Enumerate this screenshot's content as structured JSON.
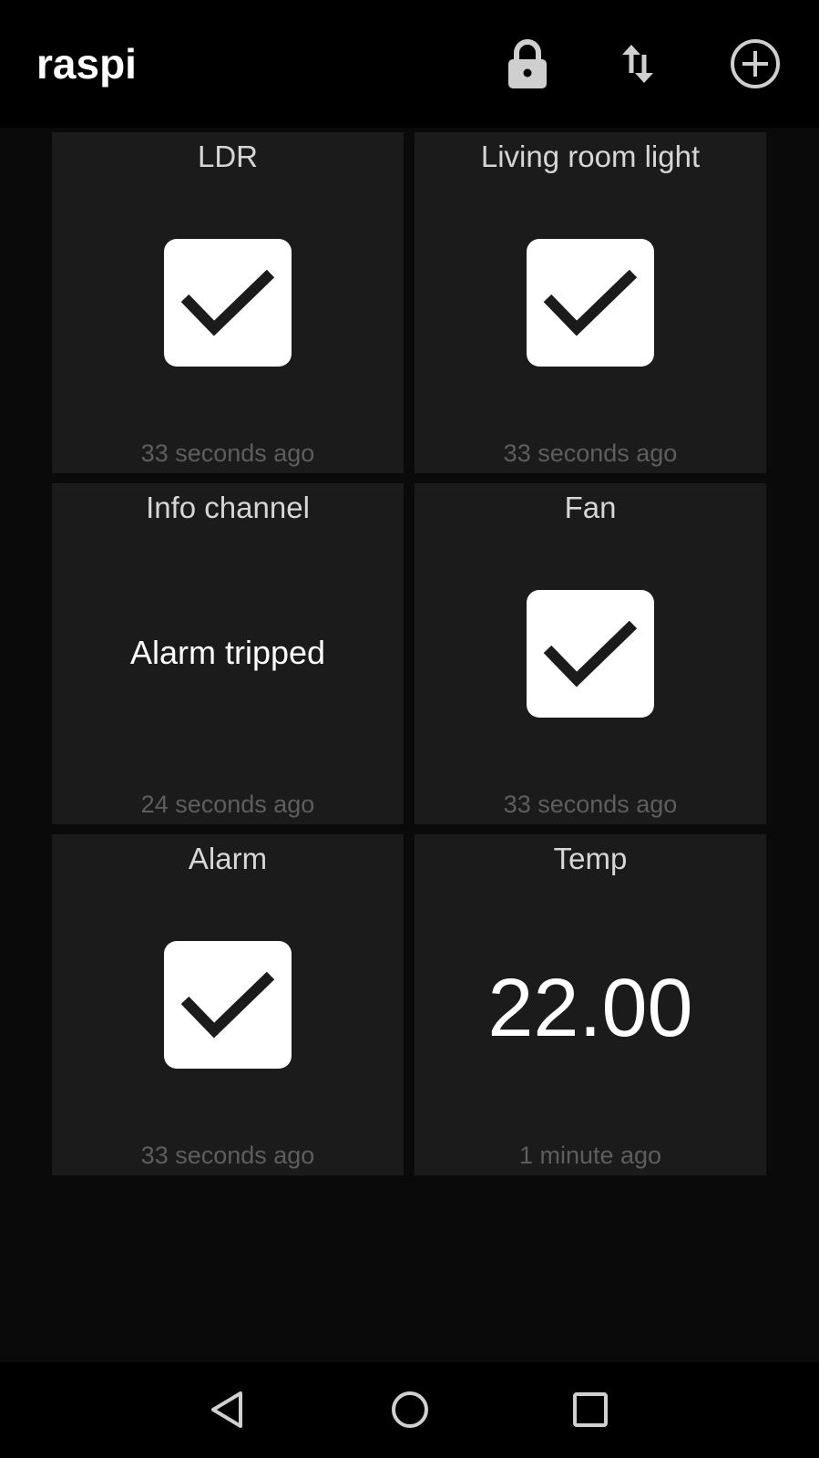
{
  "appbar": {
    "title": "raspi",
    "icons": [
      "lock-icon",
      "swap-vertical-icon",
      "add-circle-icon"
    ]
  },
  "tiles": [
    {
      "name": "LDR",
      "widget": "checkbox",
      "checked": true,
      "time": "33 seconds ago"
    },
    {
      "name": "Living room light",
      "widget": "checkbox",
      "checked": true,
      "time": "33 seconds ago"
    },
    {
      "name": "Info channel",
      "widget": "text",
      "value": "Alarm tripped",
      "time": "24 seconds ago"
    },
    {
      "name": "Fan",
      "widget": "checkbox",
      "checked": true,
      "time": "33 seconds ago"
    },
    {
      "name": "Alarm",
      "widget": "checkbox",
      "checked": true,
      "time": "33 seconds ago"
    },
    {
      "name": "Temp",
      "widget": "number",
      "value": "22.00",
      "time": "1 minute ago"
    }
  ],
  "navbar": {
    "icons": [
      "back-icon",
      "home-icon",
      "recents-icon"
    ]
  },
  "colors": {
    "background": "#0a0a0a",
    "bar": "#000000",
    "tile": "#1b1b1b",
    "tile_title": "#d6d6d6",
    "tile_time": "#5e5e5e",
    "checkbox": "#ffffff",
    "checkmark": "#1b1b1b"
  }
}
